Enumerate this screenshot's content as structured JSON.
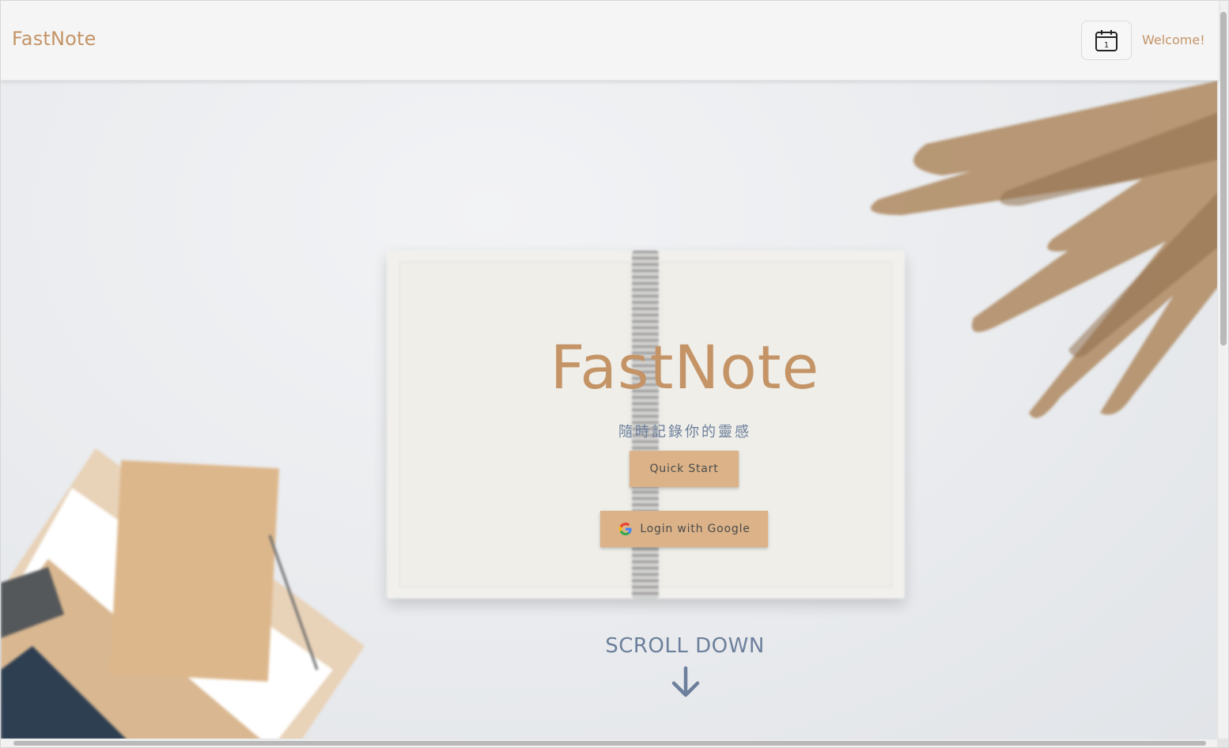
{
  "header": {
    "brand": "FastNote",
    "calendar_day": "1",
    "welcome": "Welcome!"
  },
  "hero": {
    "title": "FastNote",
    "subtitle": "隨時記錄你的靈感",
    "quick_start_label": "Quick Start",
    "google_login_label": "Login with Google",
    "scroll_label": "SCROLL DOWN"
  },
  "colors": {
    "brand": "#c49467",
    "button_bg": "#dcb388",
    "accent_blue": "#6c7f9c"
  },
  "icons": {
    "calendar": "calendar-icon",
    "google": "google-icon",
    "arrow": "arrow-down-icon"
  }
}
